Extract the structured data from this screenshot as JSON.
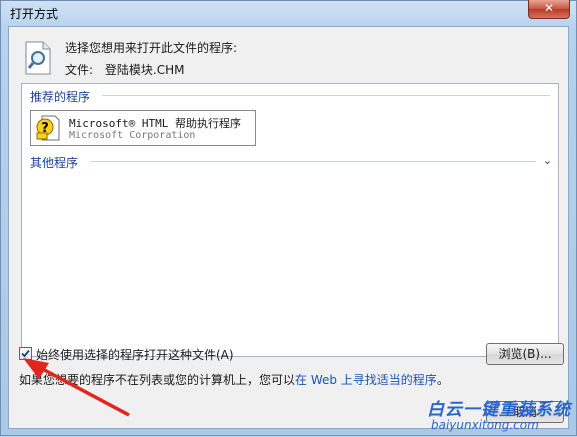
{
  "window": {
    "title": "打开方式",
    "close_label": "✕"
  },
  "prompt": "选择您想用来打开此文件的程序:",
  "file": {
    "label": "文件:",
    "name": "登陆模块.CHM"
  },
  "groups": {
    "recommended": "推荐的程序",
    "other": "其他程序"
  },
  "program": {
    "name": "Microsoft® HTML 帮助执行程序",
    "vendor": "Microsoft Corporation"
  },
  "always_use": {
    "label": "始终使用选择的程序打开这种文件(A)",
    "checked": true
  },
  "browse_label": "浏览(B)...",
  "hint": {
    "text": "如果您想要的程序不在列表或您的计算机上，您可以",
    "link": "在 Web 上寻找适当的程序",
    "suffix": "。"
  },
  "cancel_label": "取消",
  "watermark": {
    "title": "白云一键重装系统",
    "url": "baiyunxitong.com"
  },
  "colors": {
    "accent": "#1e3f8f",
    "link": "#1b53b0",
    "arrow": "#e0261f"
  }
}
